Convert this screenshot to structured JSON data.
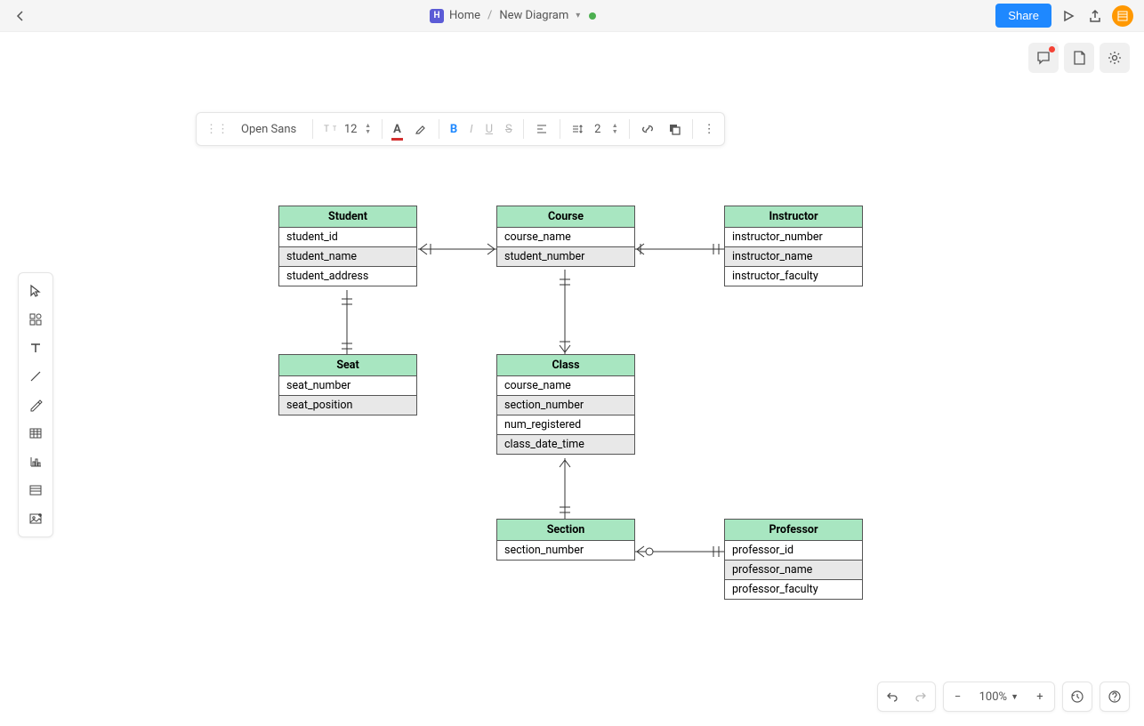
{
  "header": {
    "home": "Home",
    "doc_name": "New Diagram",
    "share": "Share"
  },
  "format_toolbar": {
    "font": "Open Sans",
    "font_size": "12",
    "stroke_width": "2"
  },
  "zoom": {
    "level": "100%"
  },
  "entities": {
    "student": {
      "title": "Student",
      "rows": [
        "student_id",
        "student_name",
        "student_address"
      ]
    },
    "course": {
      "title": "Course",
      "rows": [
        "course_name",
        "student_number"
      ]
    },
    "instructor": {
      "title": "Instructor",
      "rows": [
        "instructor_number",
        "instructor_name",
        "instructor_faculty"
      ]
    },
    "seat": {
      "title": "Seat",
      "rows": [
        "seat_number",
        "seat_position"
      ]
    },
    "class": {
      "title": "Class",
      "rows": [
        "course_name",
        "section_number",
        "num_registered",
        "class_date_time"
      ]
    },
    "section": {
      "title": "Section",
      "rows": [
        "section_number"
      ]
    },
    "professor": {
      "title": "Professor",
      "rows": [
        "professor_id",
        "professor_name",
        "professor_faculty"
      ]
    }
  }
}
